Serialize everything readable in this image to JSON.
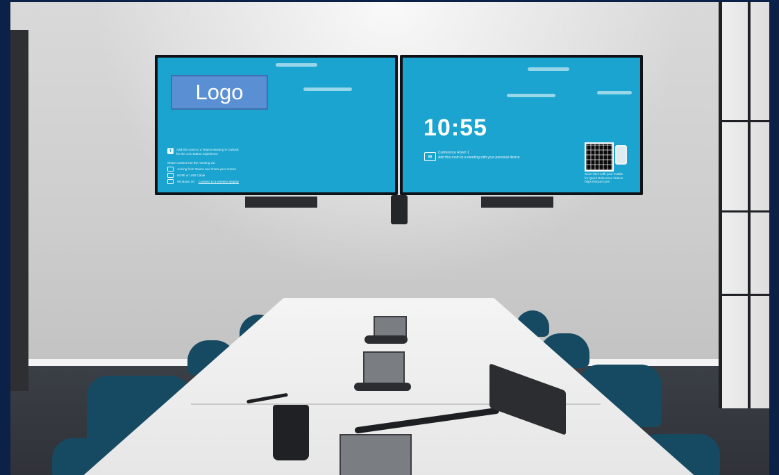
{
  "left_screen": {
    "logo_text": "Logo",
    "outlook_line1": "Add this room to a Teams Meeting in Outlook",
    "outlook_line2": "for the Join Button experience",
    "share_heading": "Share content into the meeting via",
    "share_options": [
      {
        "icon": "teams-share-icon",
        "text": "Joining from Teams and share your screen",
        "link": ""
      },
      {
        "icon": "hdmi-cable-icon",
        "text": "HDMI or USB Cable",
        "link": ""
      },
      {
        "icon": "windows-icon",
        "text": "Windows 10:",
        "link": "Connect to a wireless display"
      }
    ]
  },
  "right_screen": {
    "time": "10:55",
    "room_name": "Conference Room 1",
    "room_hint": "Add this room to a meeting with your personal device",
    "scan_line1": "Scan Here with your mobile",
    "scan_line2": "for Quick Reference Videos",
    "scan_url": "https://tinyurl.com/"
  },
  "colors": {
    "frame": "#0b2148",
    "screen": "#1ba4cf",
    "logo_box": "#5b8fd4"
  }
}
